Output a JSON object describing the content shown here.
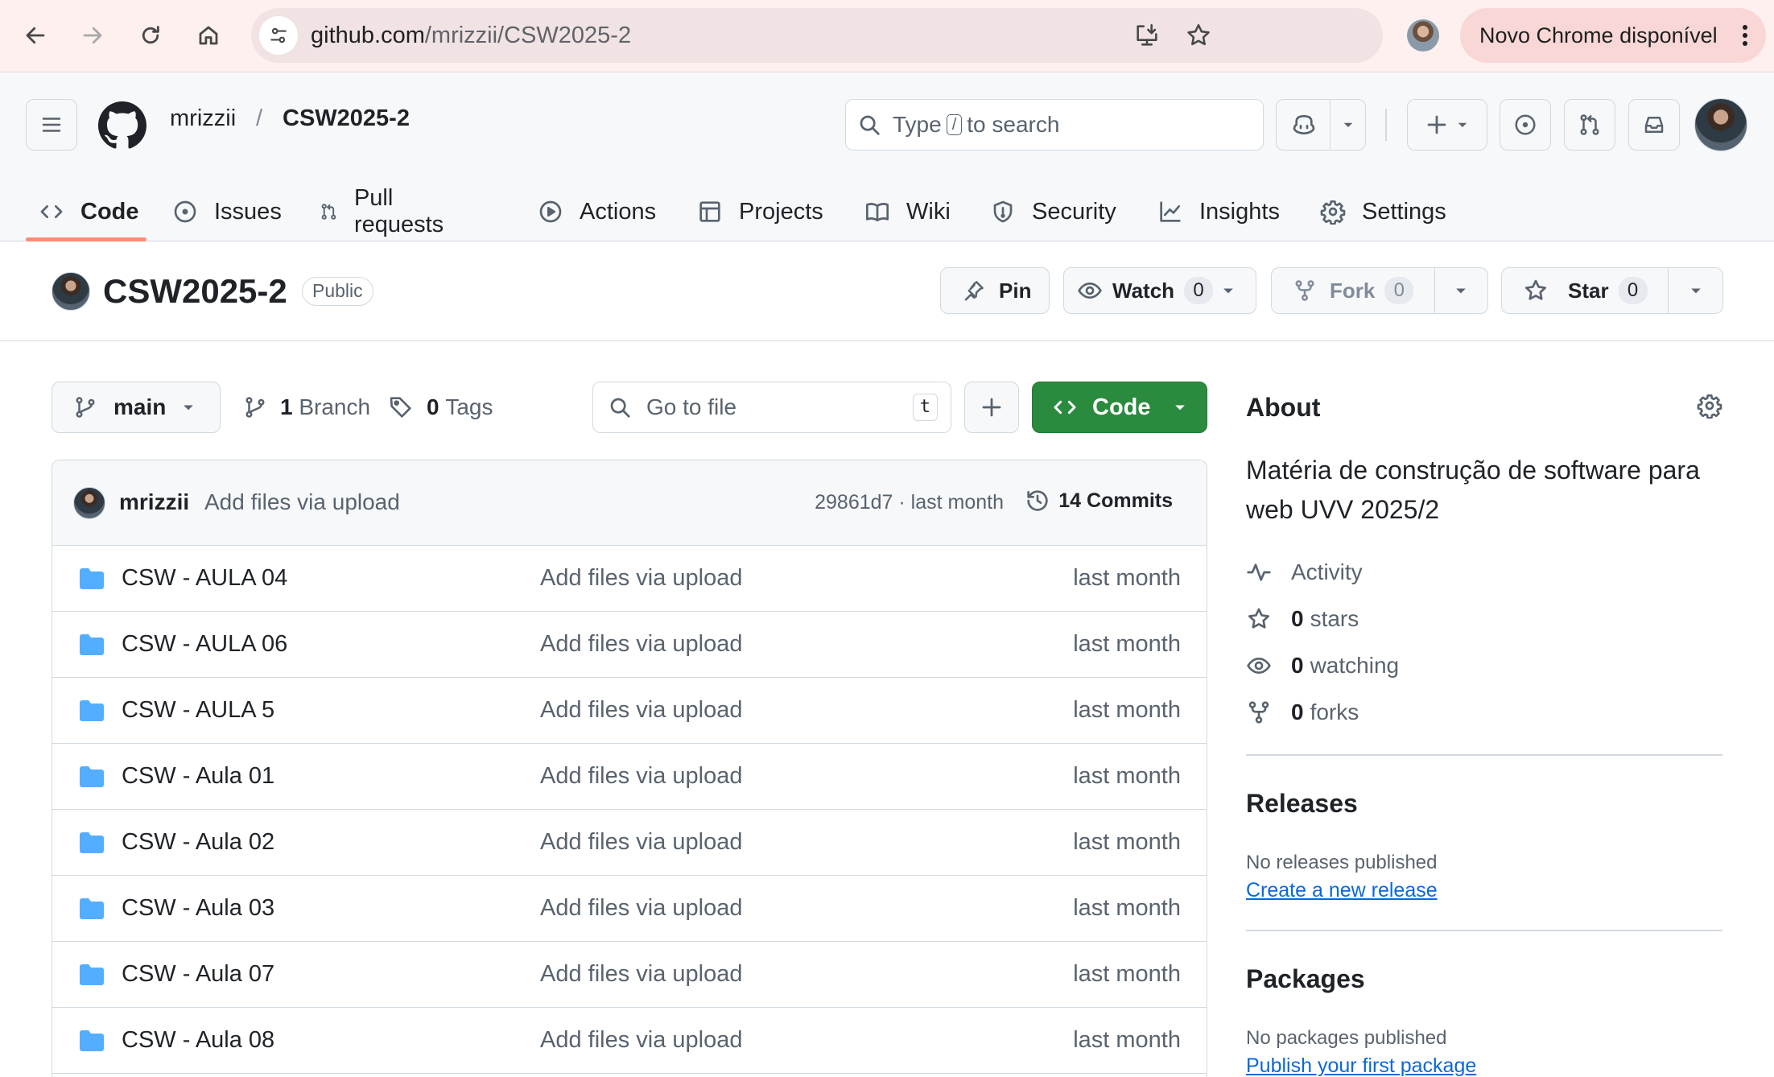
{
  "browser": {
    "url_host": "github.com",
    "url_path": "/mrizzii/CSW2025-2",
    "update_label": "Novo Chrome disponível"
  },
  "header": {
    "owner": "mrizzii",
    "separator": "/",
    "repo": "CSW2025-2",
    "search": {
      "prefix": "Type",
      "key": "/",
      "suffix": "to search"
    }
  },
  "tabs": [
    {
      "label": "Code",
      "icon": "code-icon"
    },
    {
      "label": "Issues",
      "icon": "issue-opened-icon"
    },
    {
      "label": "Pull requests",
      "icon": "git-pull-request-icon"
    },
    {
      "label": "Actions",
      "icon": "play-icon"
    },
    {
      "label": "Projects",
      "icon": "table-icon"
    },
    {
      "label": "Wiki",
      "icon": "book-icon"
    },
    {
      "label": "Security",
      "icon": "shield-icon"
    },
    {
      "label": "Insights",
      "icon": "graph-icon"
    },
    {
      "label": "Settings",
      "icon": "gear-icon"
    }
  ],
  "repo": {
    "name": "CSW2025-2",
    "visibility": "Public",
    "pin_label": "Pin",
    "watch_label": "Watch",
    "watch_count": "0",
    "fork_label": "Fork",
    "fork_count": "0",
    "star_label": "Star",
    "star_count": "0"
  },
  "controls": {
    "branch": "main",
    "branch_count": "1",
    "branch_label": "Branch",
    "tag_count": "0",
    "tag_label": "Tags",
    "goto_placeholder": "Go to file",
    "goto_key": "t",
    "code_label": "Code"
  },
  "commit": {
    "author": "mrizzii",
    "message": "Add files via upload",
    "hash_date": "29861d7 · last month",
    "commits_label": "14 Commits"
  },
  "files": [
    {
      "name": "CSW - AULA 04",
      "message": "Add files via upload",
      "date": "last month"
    },
    {
      "name": "CSW - AULA 06",
      "message": "Add files via upload",
      "date": "last month"
    },
    {
      "name": "CSW - AULA 5",
      "message": "Add files via upload",
      "date": "last month"
    },
    {
      "name": "CSW - Aula 01",
      "message": "Add files via upload",
      "date": "last month"
    },
    {
      "name": "CSW - Aula 02",
      "message": "Add files via upload",
      "date": "last month"
    },
    {
      "name": "CSW - Aula 03",
      "message": "Add files via upload",
      "date": "last month"
    },
    {
      "name": "CSW - Aula 07",
      "message": "Add files via upload",
      "date": "last month"
    },
    {
      "name": "CSW - Aula 08",
      "message": "Add files via upload",
      "date": "last month"
    }
  ],
  "about": {
    "title": "About",
    "description": "Matéria de construção de software para web UVV 2025/2",
    "activity_label": "Activity",
    "stars_count": "0",
    "stars_label": "stars",
    "watching_count": "0",
    "watching_label": "watching",
    "forks_count": "0",
    "forks_label": "forks"
  },
  "releases": {
    "title": "Releases",
    "empty_text": "No releases published",
    "link": "Create a new release"
  },
  "packages": {
    "title": "Packages",
    "empty_text": "No packages published",
    "link": "Publish your first package"
  },
  "colors": {
    "code_button": "#2a8a3e",
    "folder_icon": "#54aeff",
    "tab_underline": "#fd8c73",
    "link": "#0969da"
  }
}
